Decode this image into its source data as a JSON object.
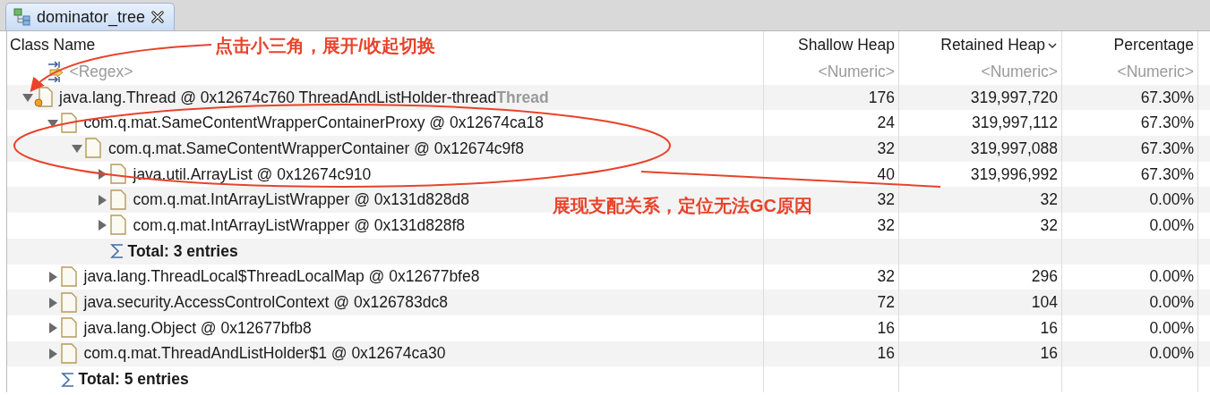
{
  "tab": {
    "title": "dominator_tree",
    "selected": true
  },
  "columns": [
    {
      "label": "Class Name",
      "sorted": false
    },
    {
      "label": "Shallow Heap",
      "sorted": false
    },
    {
      "label": "Retained Heap",
      "sorted": true
    },
    {
      "label": "Percentage",
      "sorted": false
    }
  ],
  "filter_row": {
    "class_name": "<Regex>",
    "shallow": "<Numeric>",
    "retained": "<Numeric>",
    "percentage": "<Numeric>"
  },
  "tree": [
    {
      "kind": "thread",
      "name": "java.lang.Thread @ 0x12674c760  ThreadAndListHolder-thread",
      "tag": "Thread",
      "shallow": "176",
      "retained": "319,997,720",
      "percentage": "67.30%",
      "expanded": true,
      "children": [
        {
          "kind": "object",
          "name": "com.q.mat.SameContentWrapperContainerProxy @ 0x12674ca18",
          "shallow": "24",
          "retained": "319,997,112",
          "percentage": "67.30%",
          "expanded": true,
          "children": [
            {
              "kind": "object",
              "name": "com.q.mat.SameContentWrapperContainer @ 0x12674c9f8",
              "shallow": "32",
              "retained": "319,997,088",
              "percentage": "67.30%",
              "expanded": true,
              "children": [
                {
                  "kind": "object",
                  "name": "java.util.ArrayList @ 0x12674c910",
                  "shallow": "40",
                  "retained": "319,996,992",
                  "percentage": "67.30%",
                  "expanded": false
                },
                {
                  "kind": "object",
                  "name": "com.q.mat.IntArrayListWrapper @ 0x131d828d8",
                  "shallow": "32",
                  "retained": "32",
                  "percentage": "0.00%",
                  "expanded": false
                },
                {
                  "kind": "object",
                  "name": "com.q.mat.IntArrayListWrapper @ 0x131d828f8",
                  "shallow": "32",
                  "retained": "32",
                  "percentage": "0.00%",
                  "expanded": false
                },
                {
                  "kind": "total",
                  "name": "Total: 3 entries"
                }
              ]
            }
          ]
        },
        {
          "kind": "object",
          "name": "java.lang.ThreadLocal$ThreadLocalMap @ 0x12677bfe8",
          "shallow": "32",
          "retained": "296",
          "percentage": "0.00%",
          "expanded": false
        },
        {
          "kind": "object",
          "name": "java.security.AccessControlContext @ 0x126783dc8",
          "shallow": "72",
          "retained": "104",
          "percentage": "0.00%",
          "expanded": false
        },
        {
          "kind": "object",
          "name": "java.lang.Object @ 0x12677bfb8",
          "shallow": "16",
          "retained": "16",
          "percentage": "0.00%",
          "expanded": false
        },
        {
          "kind": "object",
          "name": "com.q.mat.ThreadAndListHolder$1 @ 0x12674ca30",
          "shallow": "16",
          "retained": "16",
          "percentage": "0.00%",
          "expanded": false
        },
        {
          "kind": "total",
          "name": "Total: 5 entries"
        }
      ]
    }
  ],
  "annotations": [
    {
      "text": "点击小三角，展开/收起切换"
    },
    {
      "text": "展现支配关系，定位无法GC原因"
    }
  ]
}
